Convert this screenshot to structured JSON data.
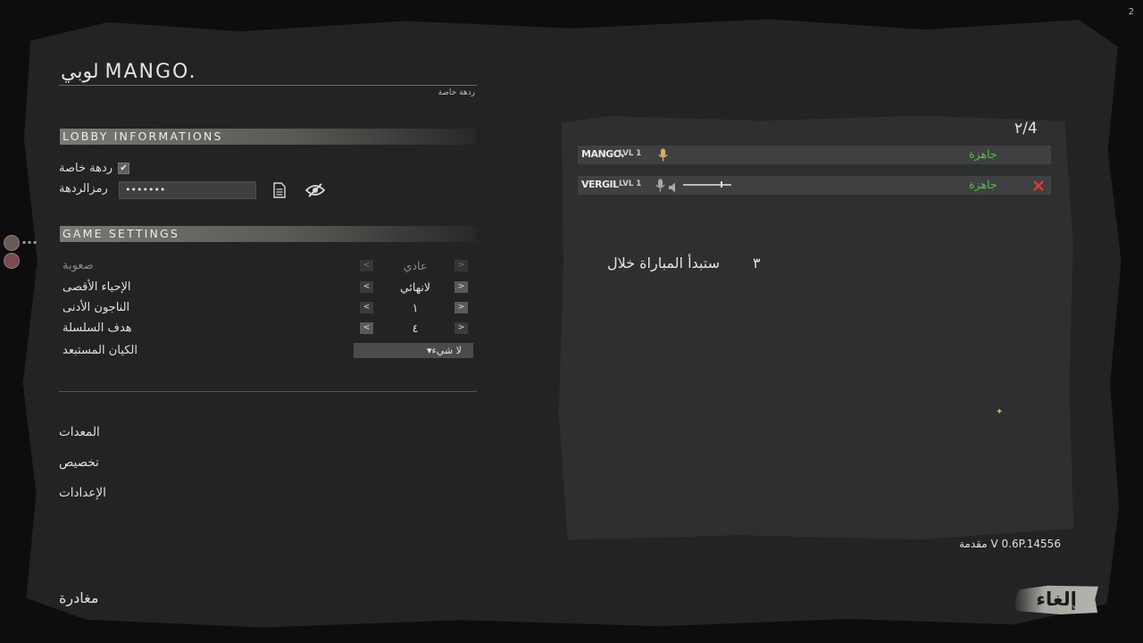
{
  "corner_badge": "2",
  "header": {
    "title": "لوبي MANGO.",
    "subtitle": "ردهة خاصة"
  },
  "lobby_info": {
    "section_title": "LOBBY INFORMATIONS",
    "private_label": "ردهة خاصة",
    "private_checked": true,
    "password_label": "رمزالردهة",
    "password_value": "•••••••",
    "copy_icon": "document-icon",
    "visibility_icon": "eye-slash-icon"
  },
  "game_settings": {
    "section_title": "GAME SETTINGS",
    "rows": [
      {
        "label": "صعوبة",
        "value": "عادي"
      },
      {
        "label": "الإحياء الأقصى",
        "value": "لانهائي"
      },
      {
        "label": "الناجون الأدنى",
        "value": "١"
      },
      {
        "label": "هدف السلسلة",
        "value": "٤"
      }
    ],
    "banished_label": "الكيان المستبعد",
    "banished_value": "لا شيء",
    "arrow_left": "<",
    "arrow_right": ">"
  },
  "menu": {
    "equipment": "المعدات",
    "customize": "تخصيص",
    "settings": "الإعدادات"
  },
  "leave_label": "مغادرة",
  "players": {
    "count": "٢/4",
    "list": [
      {
        "name": "MANGO.",
        "level": "LVL 1",
        "status": "جاهزة"
      },
      {
        "name": "VERGIL",
        "level": "LVL 1",
        "status": "جاهزة"
      }
    ]
  },
  "countdown": {
    "text": "ستبدأ المباراة خلال",
    "seconds": "٣"
  },
  "version": "مقدمة V 0.6P.14556",
  "cancel_label": "إلغاء",
  "colors": {
    "ready": "#5cbc48",
    "kick": "#d93a3a",
    "mic_active": "#d9b25a"
  }
}
